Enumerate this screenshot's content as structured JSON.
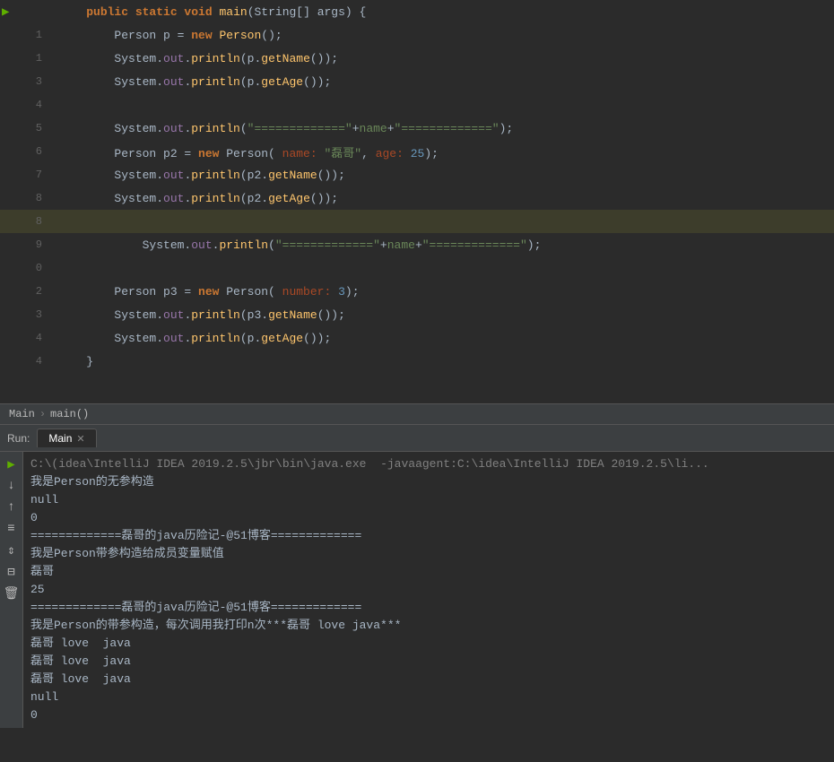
{
  "code": {
    "lines": [
      {
        "num": "",
        "content_html": "    <span class='kw'>public static void</span> <span class='method'>main</span>(String[] args) {",
        "highlighted": false,
        "has_arrow": true
      },
      {
        "num": "1",
        "content_html": "        Person p = <span class='kw'>new</span> <span class='method'>Person</span>();",
        "highlighted": false,
        "has_arrow": false
      },
      {
        "num": "1",
        "content_html": "        System.<span class='system-out'>out</span>.<span class='method'>println</span>(p.<span class='method'>getName</span>());",
        "highlighted": false,
        "has_arrow": false
      },
      {
        "num": "3",
        "content_html": "        System.<span class='system-out'>out</span>.<span class='method'>println</span>(p.<span class='method'>getAge</span>());",
        "highlighted": false,
        "has_arrow": false
      },
      {
        "num": "4",
        "content_html": "",
        "highlighted": false,
        "has_arrow": false
      },
      {
        "num": "5",
        "content_html": "        System.<span class='system-out'>out</span>.<span class='method'>println</span>(<span class='string'>\"=============\"</span>+<span class='green-var'>name</span>+<span class='string'>\"=============\"</span>);",
        "highlighted": false,
        "has_arrow": false
      },
      {
        "num": "6",
        "content_html": "        Person p2 = <span class='kw'>new</span> Person( <span class='param-name'>name:</span> <span class='string'>\"磊哥\"</span>, <span class='param-name'>age:</span> <span class='number'>25</span>);",
        "highlighted": false,
        "has_arrow": false
      },
      {
        "num": "7",
        "content_html": "        System.<span class='system-out'>out</span>.<span class='method'>println</span>(p2.<span class='method'>getName</span>());",
        "highlighted": false,
        "has_arrow": false
      },
      {
        "num": "8",
        "content_html": "        System.<span class='system-out'>out</span>.<span class='method'>println</span>(p2.<span class='method'>getAge</span>());",
        "highlighted": false,
        "has_arrow": false
      },
      {
        "num": "8",
        "content_html": "",
        "highlighted": true,
        "has_arrow": false
      },
      {
        "num": "9",
        "content_html": "            System.<span class='system-out'>out</span>.<span class='method'>println</span>(<span class='string'>\"=============\"</span>+<span class='green-var'>name</span>+<span class='string'>\"=============\"</span>);",
        "highlighted": false,
        "has_arrow": false
      },
      {
        "num": "0",
        "content_html": "",
        "highlighted": false,
        "has_arrow": false
      },
      {
        "num": "2",
        "content_html": "        Person p3 = <span class='kw'>new</span> Person( <span class='param-name'>number:</span> <span class='number'>3</span>);",
        "highlighted": false,
        "has_arrow": false
      },
      {
        "num": "3",
        "content_html": "        System.<span class='system-out'>out</span>.<span class='method'>println</span>(p3.<span class='method'>getName</span>());",
        "highlighted": false,
        "has_arrow": false
      },
      {
        "num": "4",
        "content_html": "        System.<span class='system-out'>out</span>.<span class='method'>println</span>(p.<span class='method'>getAge</span>());",
        "highlighted": false,
        "has_arrow": false
      },
      {
        "num": "4",
        "content_html": "    }",
        "highlighted": false,
        "has_arrow": false
      }
    ]
  },
  "breadcrumb": {
    "items": [
      "Main",
      "main()"
    ]
  },
  "run_panel": {
    "label": "Run:",
    "tab_label": "Main",
    "output_lines": [
      {
        "text": "C:\\(idea\\IntelliJ IDEA 2019.2.5\\jbr\\bin\\java.exe  -javaagent:C:\\idea\\IntelliJ IDEA 2019.2.5\\li...",
        "style": "gray-cmd"
      },
      {
        "text": "我是Person的无参构造",
        "style": "normal"
      },
      {
        "text": "null",
        "style": "normal"
      },
      {
        "text": "0",
        "style": "normal"
      },
      {
        "text": "=============磊哥的java历险记-@51博客=============",
        "style": "normal"
      },
      {
        "text": "我是Person带参构造给成员变量赋值",
        "style": "normal"
      },
      {
        "text": "磊哥",
        "style": "normal"
      },
      {
        "text": "25",
        "style": "normal"
      },
      {
        "text": "=============磊哥的java历险记-@51博客=============",
        "style": "normal"
      },
      {
        "text": "我是Person的带参构造，每次调用我打印n次***磊哥 love java***",
        "style": "normal"
      },
      {
        "text": "磊哥 love  java",
        "style": "normal"
      },
      {
        "text": "磊哥 love  java",
        "style": "normal"
      },
      {
        "text": "磊哥 love  java",
        "style": "normal"
      },
      {
        "text": "null",
        "style": "normal"
      },
      {
        "text": "0",
        "style": "normal"
      }
    ],
    "toolbar_buttons": [
      "▶",
      "↓",
      "↑",
      "≡",
      "↕",
      "⊟",
      "🗑"
    ]
  }
}
